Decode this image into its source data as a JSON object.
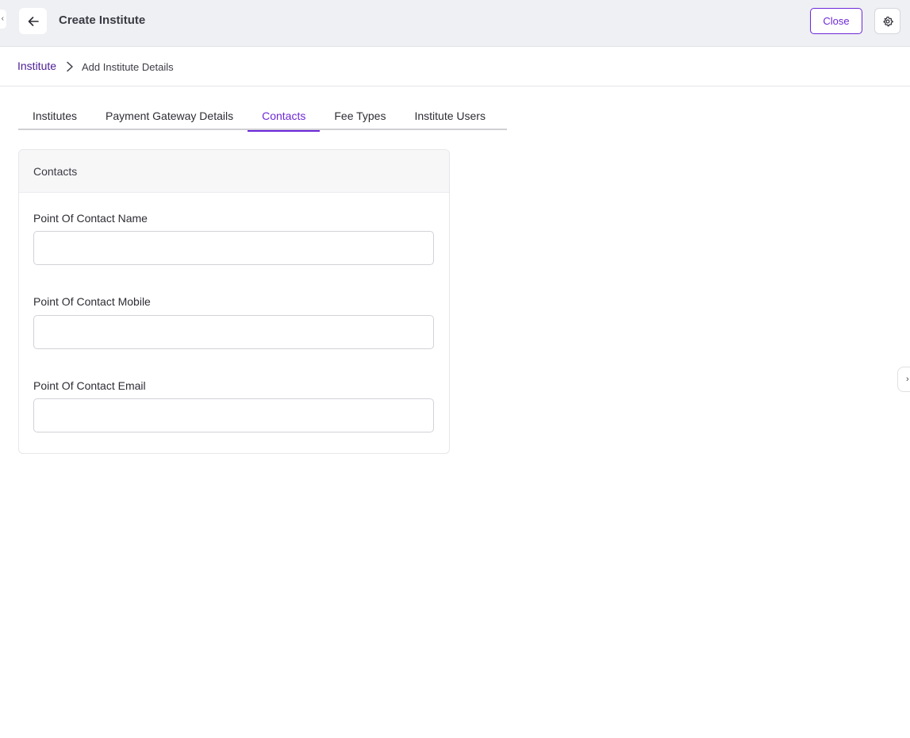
{
  "header": {
    "title": "Create Institute",
    "close_label": "Close",
    "icons": {
      "back": "arrow-left-icon",
      "settings": "gear-icon",
      "left_edge": "chevron-left-icon",
      "right_edge": "chevron-right-icon"
    },
    "left_edge_glyph": "‹",
    "right_edge_glyph": "›"
  },
  "breadcrumb": {
    "root": "Institute",
    "current": "Add Institute Details"
  },
  "tabs": [
    {
      "label": "Institutes",
      "active": false
    },
    {
      "label": "Payment Gateway Details",
      "active": false
    },
    {
      "label": "Contacts",
      "active": true
    },
    {
      "label": "Fee Types",
      "active": false
    },
    {
      "label": "Institute Users",
      "active": false
    }
  ],
  "contacts_card": {
    "title": "Contacts",
    "fields": [
      {
        "label": "Point Of Contact Name",
        "value": ""
      },
      {
        "label": "Point Of Contact Mobile",
        "value": ""
      },
      {
        "label": "Point Of Contact Email",
        "value": ""
      }
    ]
  },
  "colors": {
    "accent": "#6d28d9",
    "breadcrumb_link": "#4c1d95",
    "topbar_bg": "#eff0f3"
  }
}
